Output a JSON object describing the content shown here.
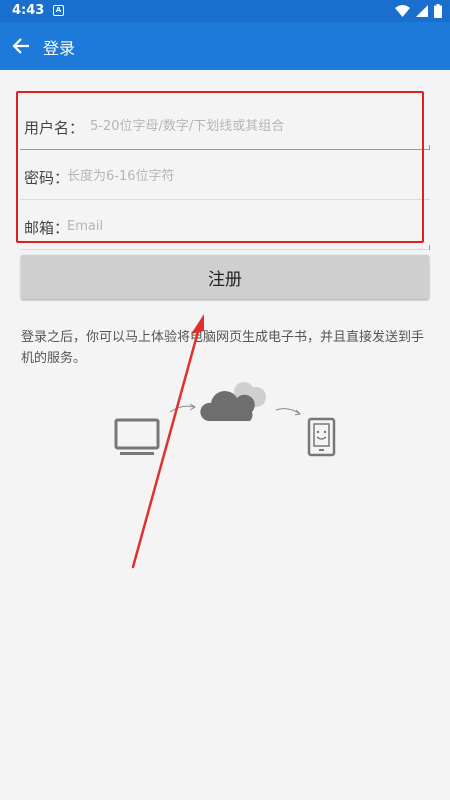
{
  "status_bar": {
    "time": "4:43",
    "notification_letter": "A"
  },
  "app_bar": {
    "title": "登录"
  },
  "form": {
    "username": {
      "label": "用户名：",
      "placeholder": "5-20位字母/数字/下划线或其组合"
    },
    "password": {
      "label": "密码：",
      "placeholder": "长度为6-16位字符"
    },
    "email": {
      "label": "邮箱：",
      "placeholder": "Email"
    }
  },
  "register_button": {
    "label": "注册"
  },
  "description": "登录之后，你可以马上体验将电脑网页生成电子书，并且直接发送到手机的服务。",
  "icons": {
    "back": "back-arrow-icon",
    "wifi": "wifi-icon",
    "signal": "signal-icon",
    "battery": "battery-icon",
    "monitor": "monitor-icon",
    "cloud": "cloud-icon",
    "phone": "phone-smiley-icon"
  },
  "colors": {
    "status_bar": "#1a6fce",
    "app_bar": "#1e7ad9",
    "highlight_box": "#e02020",
    "active_underline": "#e0863c",
    "button": "#cfcfcf"
  }
}
